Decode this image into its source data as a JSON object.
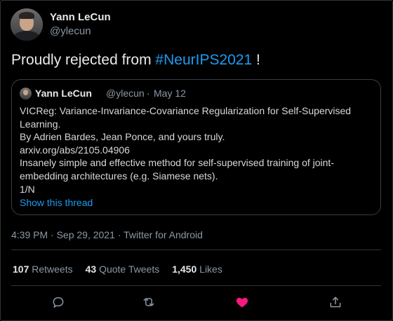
{
  "author": {
    "name": "Yann LeCun",
    "handle": "@ylecun"
  },
  "tweet": {
    "text_before": "Proudly rejected from ",
    "hashtag": "#NeurIPS2021",
    "text_after": " !"
  },
  "quote": {
    "author_name": "Yann LeCun",
    "author_handle": "@ylecun",
    "separator": "·",
    "date": "May 12",
    "lines": [
      "VICReg: Variance-Invariance-Covariance Regularization for Self-Supervised",
      "Learning.",
      "By Adrien Bardes, Jean Ponce, and yours truly.",
      "arxiv.org/abs/2105.04906",
      "Insanely simple and effective method for self-supervised training of joint-",
      "embedding architectures (e.g. Siamese nets).",
      "1/N"
    ],
    "show_thread": "Show this thread"
  },
  "meta": "4:39 PM · Sep 29, 2021 · Twitter for Android",
  "stats": {
    "retweets_count": "107",
    "retweets_label": "Retweets",
    "quotes_count": "43",
    "quotes_label": "Quote Tweets",
    "likes_count": "1,450",
    "likes_label": "Likes"
  },
  "actions": {
    "reply_icon": "reply-icon",
    "retweet_icon": "retweet-icon",
    "like_icon": "heart-icon",
    "share_icon": "share-icon",
    "like_color": "#f91880",
    "icon_color": "#8b98a5",
    "accent_color": "#1d9bf0"
  }
}
